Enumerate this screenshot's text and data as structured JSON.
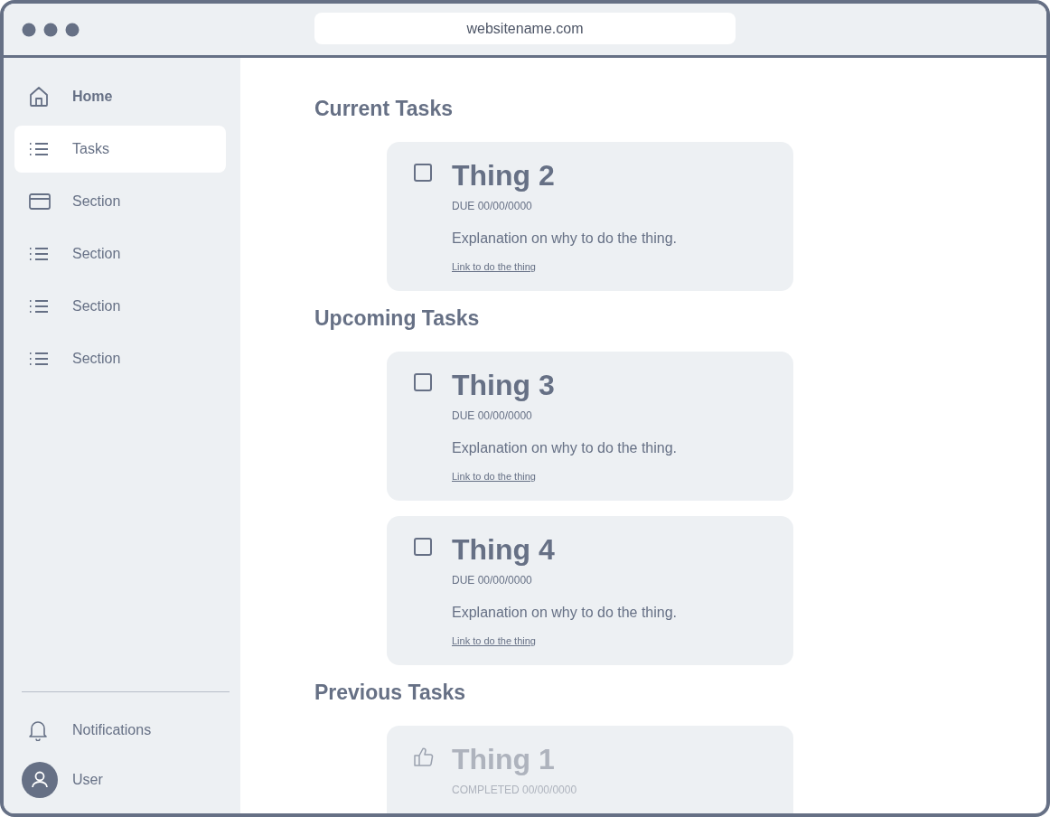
{
  "window": {
    "address": "websitename.com"
  },
  "sidebar": {
    "items": [
      {
        "label": "Home",
        "selected": false,
        "bold": true
      },
      {
        "label": "Tasks",
        "selected": true,
        "bold": false
      },
      {
        "label": "Section",
        "selected": false,
        "bold": false
      },
      {
        "label": "Section",
        "selected": false,
        "bold": false
      },
      {
        "label": "Section",
        "selected": false,
        "bold": false
      },
      {
        "label": "Section",
        "selected": false,
        "bold": false
      }
    ],
    "footer": [
      {
        "label": "Notifications"
      },
      {
        "label": "User"
      }
    ]
  },
  "sections": [
    {
      "title": "Current Tasks",
      "tasks": [
        {
          "kind": "open",
          "checked": false,
          "title": "Thing 2",
          "date": "DUE 00/00/0000",
          "explanation": "Explanation on why to do the thing.",
          "link": "Link to do the thing"
        }
      ]
    },
    {
      "title": "Upcoming Tasks",
      "tasks": [
        {
          "kind": "open",
          "checked": false,
          "title": "Thing 3",
          "date": "DUE 00/00/0000",
          "explanation": "Explanation on why to do the thing.",
          "link": "Link to do the thing"
        },
        {
          "kind": "open",
          "checked": false,
          "title": "Thing 4",
          "date": "DUE 00/00/0000",
          "explanation": "Explanation on why to do the thing.",
          "link": "Link to do the thing"
        }
      ]
    },
    {
      "title": "Previous Tasks",
      "tasks": [
        {
          "kind": "completed",
          "title": "Thing 1",
          "date": "COMPLETED 00/00/0000"
        }
      ]
    }
  ]
}
